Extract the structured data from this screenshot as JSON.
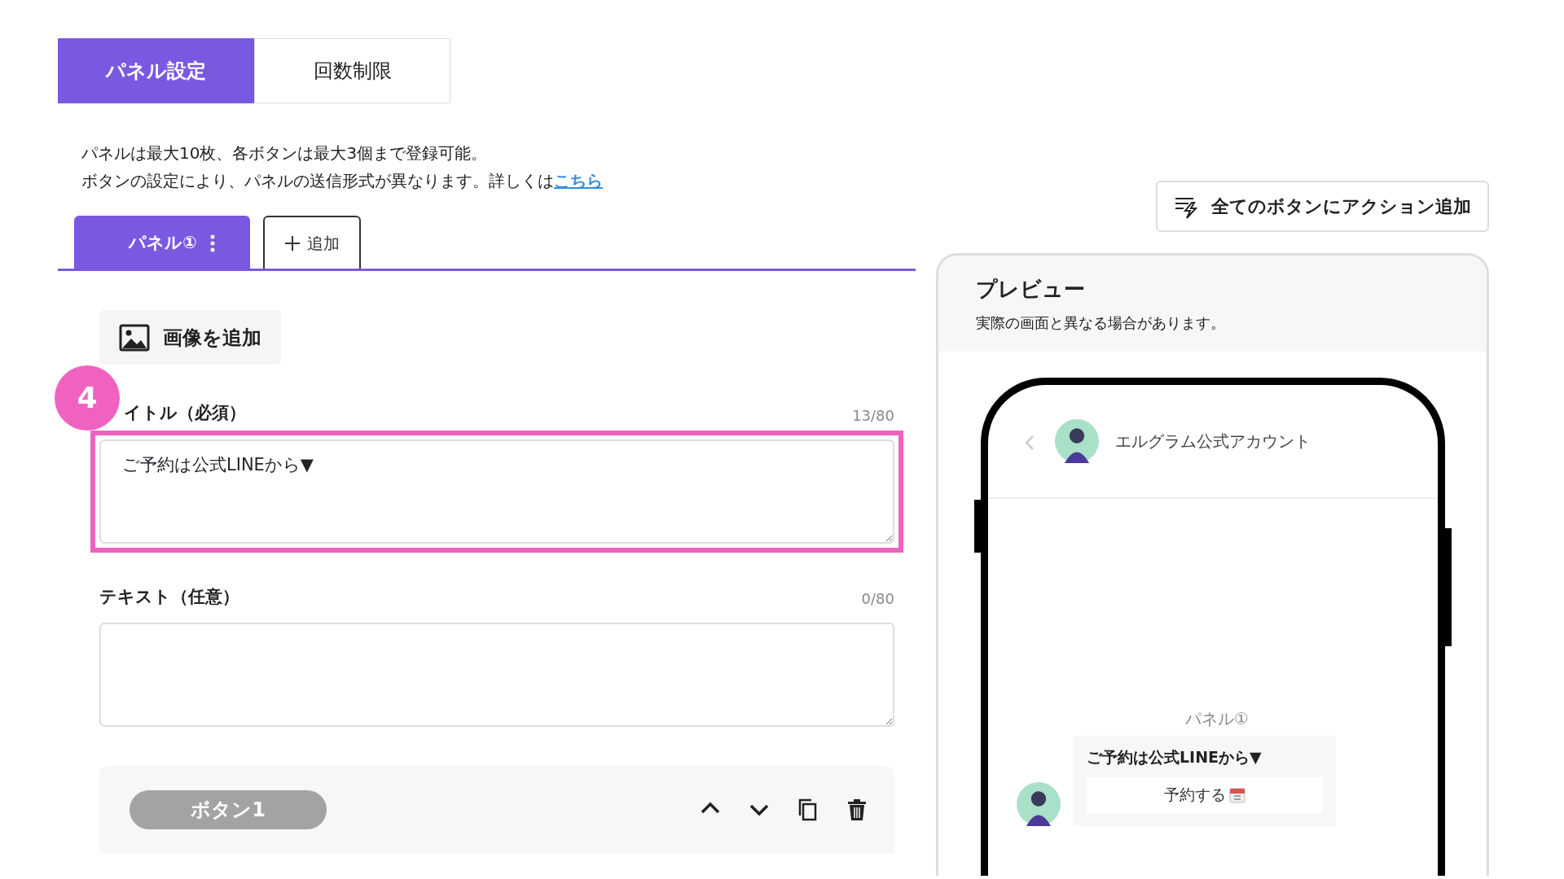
{
  "top_tabs": [
    {
      "label": "パネル設定",
      "selected": true
    },
    {
      "label": "回数制限",
      "selected": false
    }
  ],
  "notice": {
    "lines": [
      "パネルは最大10枚、各ボタンは最大3個まで登録可能。",
      "ボタンの設定により、パネルの送信形式が異なります。詳しくは"
    ],
    "link": "こちら"
  },
  "panel_tabs": [
    {
      "label": "パネル①",
      "selected": true
    }
  ],
  "add_tab": {
    "label": "追加"
  },
  "add_image_button": {
    "label": "画像を追加"
  },
  "fields": [
    {
      "label": "イトル（必須）",
      "counter": "13/80",
      "value": "ご予約は公式LINEから▼",
      "highlighted": true,
      "callout": "4"
    },
    {
      "label": "テキスト（任意）",
      "counter": "0/80",
      "highlighted": false
    }
  ],
  "button_card": {
    "label": "ボタン1"
  },
  "action_button": {
    "label": "全てのボタンにアクション追加"
  },
  "preview": {
    "title": "プレビュー",
    "subtitle": "実際の画面と異なる場合があります。",
    "account_name": "エルグラム公式アカウント",
    "panel_label": "パネル①",
    "message_title": "ご予約は公式LINEから▼",
    "message_button": "予約する"
  }
}
